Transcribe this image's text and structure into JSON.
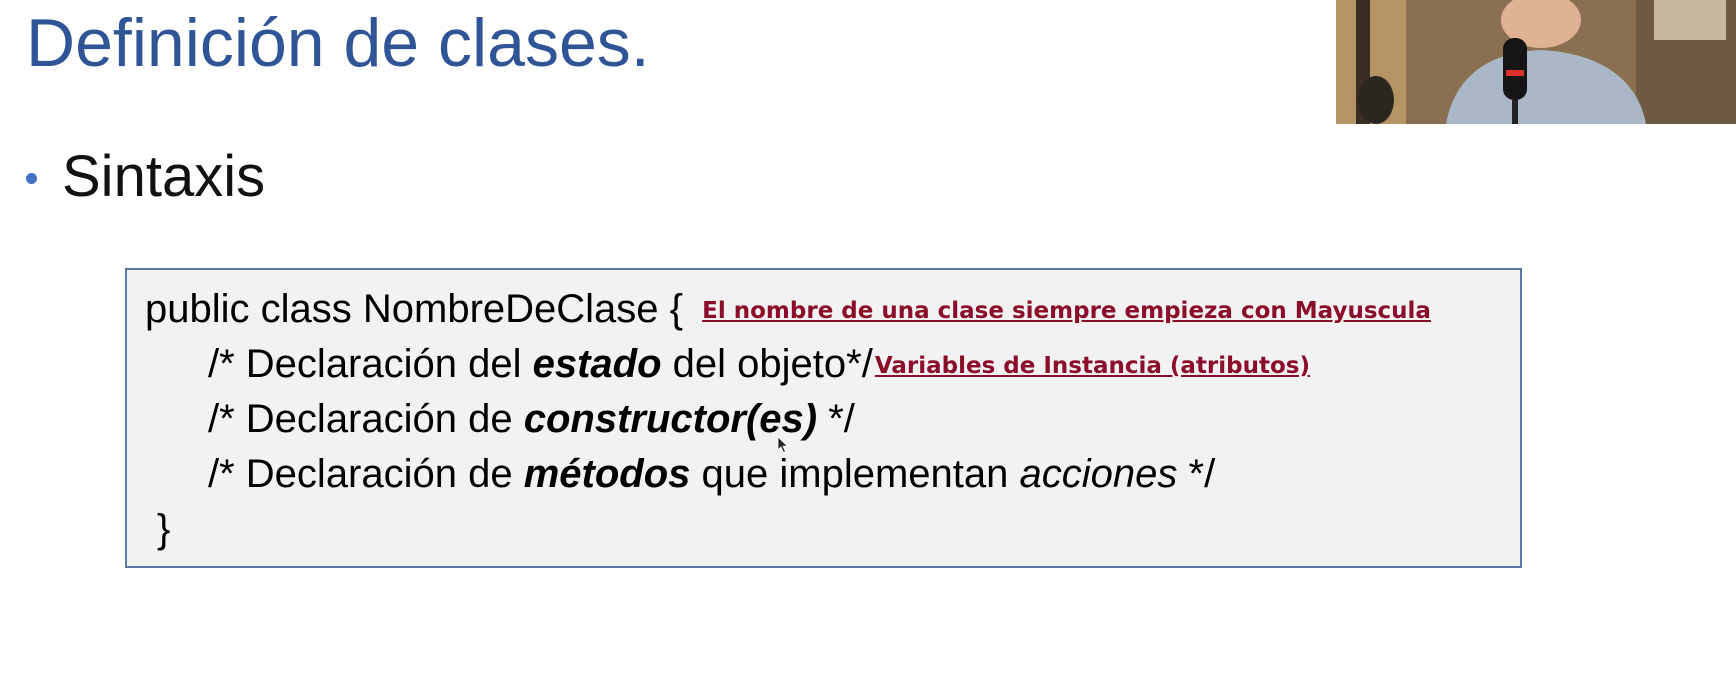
{
  "slide": {
    "title": "Definición de clases.",
    "bullet": "Sintaxis"
  },
  "code": {
    "line1": {
      "text": "public class NombreDeClase {",
      "note": "El nombre de una clase siempre empieza con Mayuscula"
    },
    "line2": {
      "pre": "/* Declaración del ",
      "strong": "estado",
      "post": " del objeto*/",
      "note": "Variables de Instancia (atributos)"
    },
    "line3": {
      "pre": "/* Declaración de ",
      "strong": "constructor(es)",
      "post": " */"
    },
    "line4": {
      "pre": "/* Declaración de ",
      "strong": "métodos",
      "mid": " que implementan ",
      "ital": "acciones",
      "post": " */"
    },
    "line5": {
      "text": "}"
    }
  },
  "colors": {
    "title": "#2f5597",
    "bullet": "#4472c4",
    "note": "#8b0d2a",
    "box_border": "#5b77a8",
    "box_fill": "#f2f2f2"
  },
  "icons": {
    "cursor": "mouse-pointer-icon",
    "webcam": "presenter-webcam-overlay"
  }
}
